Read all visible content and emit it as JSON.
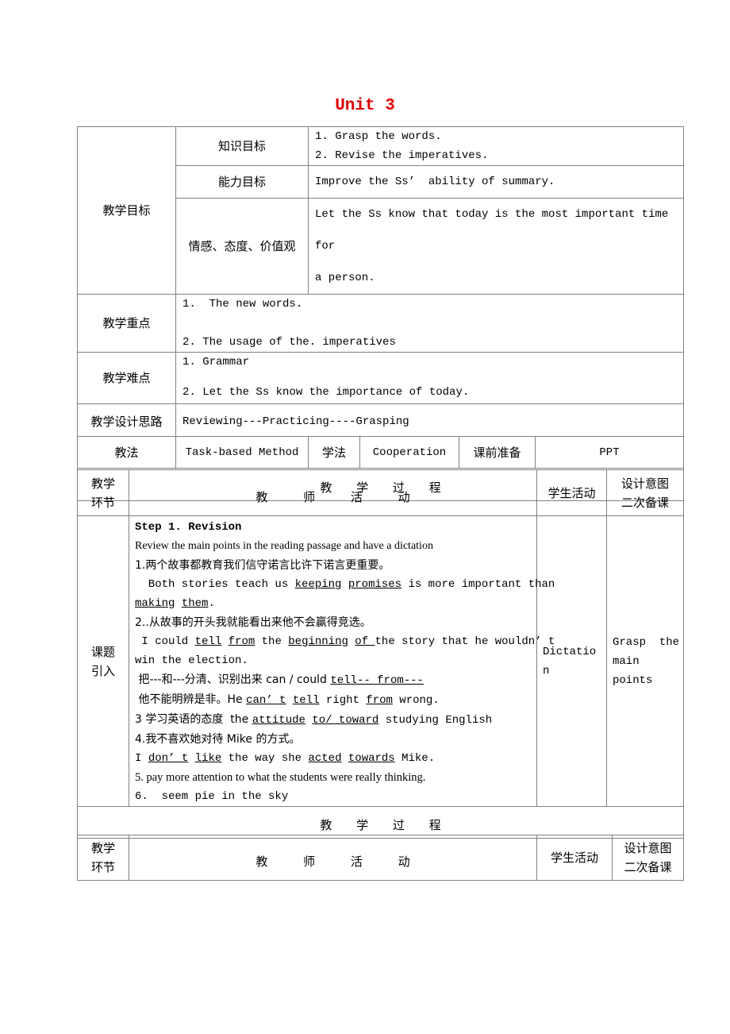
{
  "doc_title": "Unit 3",
  "objectives": {
    "label": "教学目标",
    "knowledge": {
      "label": "知识目标",
      "lines": [
        "1. Grasp the words.",
        "2. Revise the imperatives."
      ]
    },
    "ability": {
      "label": "能力目标",
      "text": "Improve the Ss’  ability of summary."
    },
    "emotion": {
      "label": "情感、态度、价值观",
      "lines": [
        "Let the Ss know that today is the most important time for",
        "a person."
      ]
    }
  },
  "key_points": {
    "label": "教学重点",
    "lines": [
      "1.  The new words.",
      "2. The usage of the. imperatives"
    ]
  },
  "difficulties": {
    "label": "教学难点",
    "lines": [
      "1. Grammar",
      "2. Let the Ss know the importance of today."
    ]
  },
  "design_idea": {
    "label": "教学设计思路",
    "text": "Reviewing---Practicing----Grasping"
  },
  "methods": {
    "teaching_label": "教法",
    "teaching_value": "Task-based Method",
    "learning_label": "学法",
    "learning_value": "Cooperation",
    "prep_label": "课前准备",
    "prep_value": "PPT"
  },
  "process": {
    "heading": "教 学 过 程",
    "col_stage": [
      "教学",
      "环节"
    ],
    "col_teacher": "教 师 活 动",
    "col_student": "学生活动",
    "col_intent": [
      "设计意图",
      "二次备课"
    ]
  },
  "step1": {
    "stage": [
      "课题",
      "引入"
    ],
    "title": "Step 1. Revision",
    "intro": "Review the main points in the reading passage and have a dictation",
    "s1_cn": "1.两个故事都教育我们信守诺言比许下诺言更重要。",
    "s1_a": "  Both stories teach us ",
    "s1_u1": "keeping",
    "s1_u2": "promises",
    "s1_b": " is more important than",
    "s1_u3": "making",
    "s1_u4": "them",
    "s1_c": ".",
    "s2_cn": "2..从故事的开头我就能看出来他不会赢得竞选。",
    "s2_a": " I could ",
    "s2_u1": "tell",
    "s2_u2": "from",
    "s2_b": " the ",
    "s2_u3": "beginning",
    "s2_u4": "of ",
    "s2_c": "the story that he wouldn’ t",
    "s2_d": "win the election.",
    "s2_e_cn": " 把---和---分清、识别出来 can / could ",
    "s2_e_u": "tell-- from---",
    "s2_f_cn": " 他不能明辨是非。He ",
    "s2_f_u1": "can’ t",
    "s2_f_u2": "tell",
    "s2_f_b": " right ",
    "s2_f_u3": "from",
    "s2_f_c": " wrong.",
    "s3_cn": "3 学习英语的态度  the ",
    "s3_u1": "attitude",
    "s3_u2": "to/ toward",
    "s3_b": " studying English",
    "s4_cn": "4.我不喜欢她对待 Mike 的方式。",
    "s4_a": "I ",
    "s4_u1": "don’ t",
    "s4_u2": "like",
    "s4_b": " the way she ",
    "s4_u3": "acted",
    "s4_u4": "towards",
    "s4_c": " Mike.",
    "s5": "5. pay more attention to what the students were really thinking.",
    "s6": "6.  seem pie in the sky",
    "student_activity": [
      "Dictatio",
      "n"
    ],
    "intent": [
      "Grasp  the",
      "main",
      "points"
    ]
  }
}
